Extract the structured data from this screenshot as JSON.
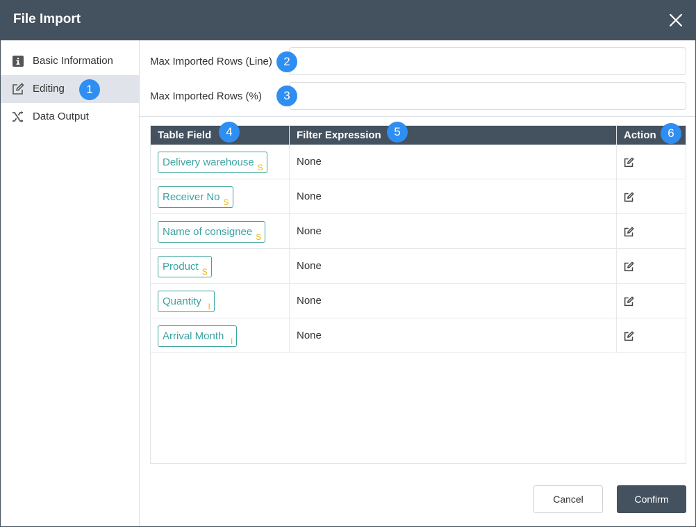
{
  "dialog": {
    "title": "File Import"
  },
  "sidebar": {
    "items": [
      {
        "label": "Basic Information",
        "icon": "info-icon"
      },
      {
        "label": "Editing",
        "icon": "edit-icon",
        "active": true
      },
      {
        "label": "Data Output",
        "icon": "shuffle-icon"
      }
    ]
  },
  "form": {
    "max_rows_line": {
      "label": "Max Imported Rows (Line)",
      "value": ""
    },
    "max_rows_percent": {
      "label": "Max Imported Rows (%)",
      "value": ""
    }
  },
  "table": {
    "headers": [
      "Table Field",
      "Filter Expression",
      "Action"
    ],
    "rows": [
      {
        "field": "Delivery warehouse",
        "type": "S",
        "filter": "None"
      },
      {
        "field": "Receiver No",
        "type": "S",
        "filter": "None"
      },
      {
        "field": "Name of consignee",
        "type": "S",
        "filter": "None"
      },
      {
        "field": "Product",
        "type": "S",
        "filter": "None"
      },
      {
        "field": "Quantity",
        "type": "I",
        "filter": "None"
      },
      {
        "field": "Arrival Month",
        "type": "I",
        "filter": "None"
      }
    ]
  },
  "markers": [
    "1",
    "2",
    "3",
    "4",
    "5",
    "6"
  ],
  "footer": {
    "cancel_label": "Cancel",
    "confirm_label": "Confirm"
  },
  "colors": {
    "header_bg": "#44515e",
    "accent": "#2e8ef2",
    "tag_border": "#3aa3a0",
    "type_badge": "#f0b400"
  }
}
